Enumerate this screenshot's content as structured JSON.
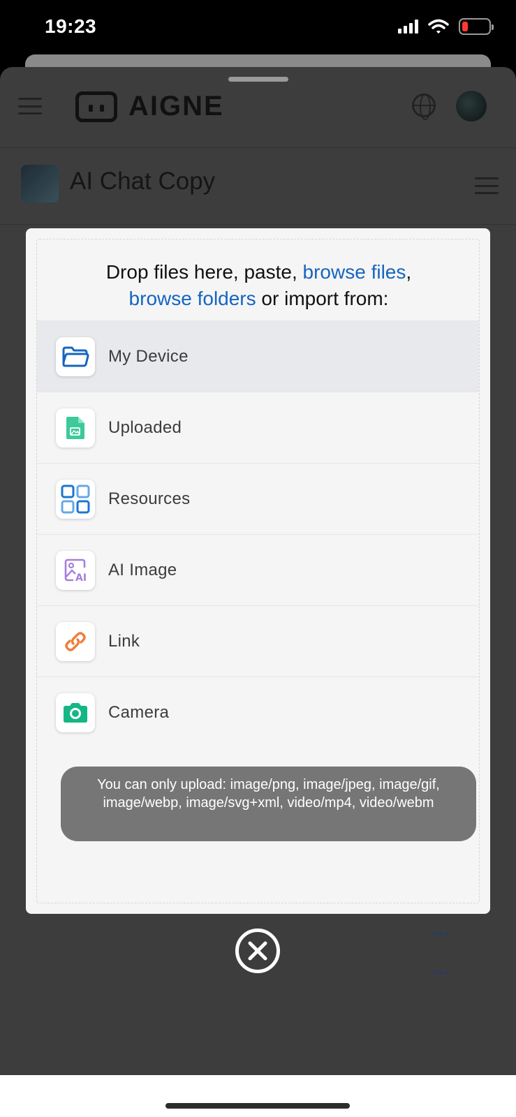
{
  "status_bar": {
    "time": "19:23"
  },
  "app": {
    "logo_text": "AIGNE",
    "title": "AI Chat Copy"
  },
  "uploader": {
    "drop_prefix": "Drop files here, paste, ",
    "browse_files": "browse files",
    "comma": ",",
    "browse_folders": "browse folders",
    "drop_suffix": " or import from:",
    "sources": [
      {
        "label": "My Device",
        "icon": "folder-icon",
        "color": "#1565c0",
        "active": true
      },
      {
        "label": "Uploaded",
        "icon": "image-file-icon",
        "color": "#3dc99a",
        "active": false
      },
      {
        "label": "Resources",
        "icon": "grid-icon",
        "color": "#1976d2",
        "active": false
      },
      {
        "label": "AI Image",
        "icon": "ai-image-icon",
        "color": "#a77ddc",
        "active": false
      },
      {
        "label": "Link",
        "icon": "link-icon",
        "color": "#ef7d3c",
        "active": false
      },
      {
        "label": "Camera",
        "icon": "camera-icon",
        "color": "#14b784",
        "active": false
      }
    ],
    "restriction_toast": "You can only upload: image/png, image/jpeg, image/gif, image/webp, image/svg+xml, video/mp4, video/webm"
  },
  "background_row_menu": "..."
}
